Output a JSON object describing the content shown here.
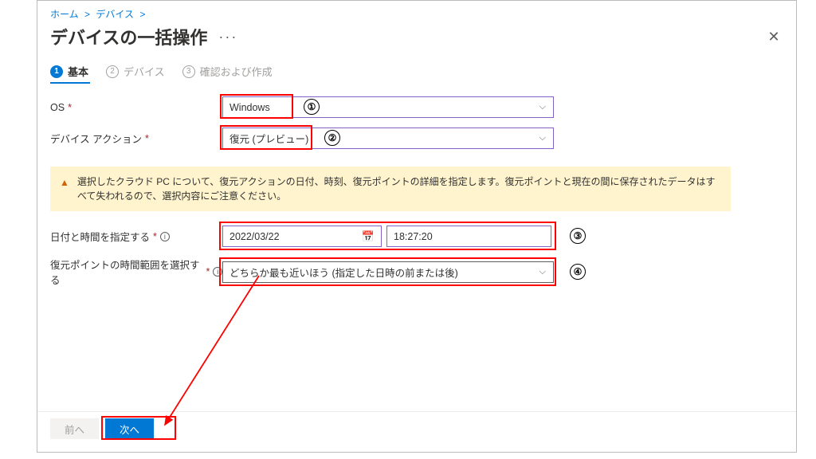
{
  "breadcrumb": {
    "home": "ホーム",
    "devices": "デバイス"
  },
  "header": {
    "title": "デバイスの一括操作"
  },
  "steps": {
    "step1": "基本",
    "step2": "デバイス",
    "step3": "確認および作成"
  },
  "form": {
    "os_label": "OS",
    "os_value": "Windows",
    "action_label": "デバイス アクション",
    "action_value": "復元 (プレビュー)",
    "warning_text": "選択したクラウド PC について、復元アクションの日付、時刻、復元ポイントの詳細を指定します。復元ポイントと現在の間に保存されたデータはすべて失われるので、選択内容にご注意ください。",
    "datetime_label": "日付と時間を指定する",
    "date_value": "2022/03/22",
    "time_value": "18:27:20",
    "range_label": "復元ポイントの時間範囲を選択する",
    "range_value": "どちらか最も近いほう (指定した日時の前または後)"
  },
  "footer": {
    "prev": "前へ",
    "next": "次へ"
  },
  "annotations": {
    "n1": "①",
    "n2": "②",
    "n3": "③",
    "n4": "④"
  }
}
